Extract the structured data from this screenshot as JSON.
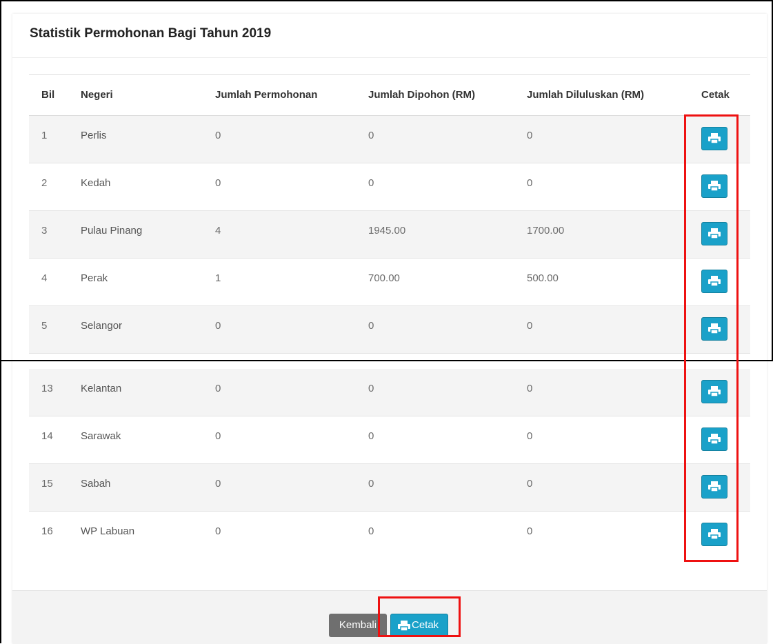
{
  "panel": {
    "title": "Statistik Permohonan Bagi Tahun 2019"
  },
  "table": {
    "headers": {
      "bil": "Bil",
      "negeri": "Negeri",
      "jumlah_permohonan": "Jumlah Permohonan",
      "jumlah_dipohon": "Jumlah Dipohon (RM)",
      "jumlah_diluluskan": "Jumlah Diluluskan (RM)",
      "cetak": "Cetak"
    },
    "rows": [
      {
        "bil": "1",
        "negeri": "Perlis",
        "permohonan": "0",
        "dipohon": "0",
        "diluluskan": "0"
      },
      {
        "bil": "2",
        "negeri": "Kedah",
        "permohonan": "0",
        "dipohon": "0",
        "diluluskan": "0"
      },
      {
        "bil": "3",
        "negeri": "Pulau Pinang",
        "permohonan": "4",
        "dipohon": "1945.00",
        "diluluskan": "1700.00"
      },
      {
        "bil": "4",
        "negeri": "Perak",
        "permohonan": "1",
        "dipohon": "700.00",
        "diluluskan": "500.00"
      },
      {
        "bil": "5",
        "negeri": "Selangor",
        "permohonan": "0",
        "dipohon": "0",
        "diluluskan": "0"
      },
      {
        "bil": "13",
        "negeri": "Kelantan",
        "permohonan": "0",
        "dipohon": "0",
        "diluluskan": "0"
      },
      {
        "bil": "14",
        "negeri": "Sarawak",
        "permohonan": "0",
        "dipohon": "0",
        "diluluskan": "0"
      },
      {
        "bil": "15",
        "negeri": "Sabah",
        "permohonan": "0",
        "dipohon": "0",
        "diluluskan": "0"
      },
      {
        "bil": "16",
        "negeri": "WP Labuan",
        "permohonan": "0",
        "dipohon": "0",
        "diluluskan": "0"
      }
    ]
  },
  "footer": {
    "kembali_label": "Kembali",
    "cetak_label": "Cetak"
  },
  "icons": {
    "row_print": "print-icon",
    "footer_print": "print-icon"
  },
  "colors": {
    "primary_button": "#1aa1c9",
    "secondary_button": "#6f6f6f",
    "highlight": "#e11111"
  }
}
